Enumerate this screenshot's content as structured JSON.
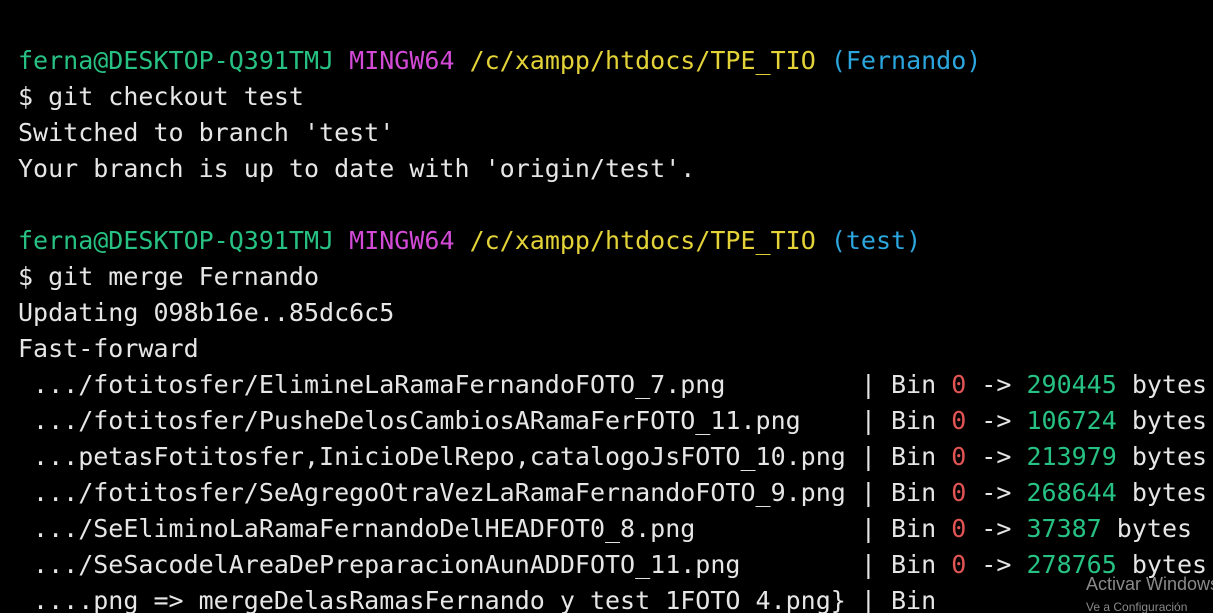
{
  "colors": {
    "background": "#000000",
    "foreground": "#e6e6e6",
    "user_host": "#27c283",
    "msystem": "#d24ad6",
    "path": "#e3d338",
    "branch": "#2ba6de",
    "removed": "#e45454",
    "added": "#27c283"
  },
  "prompts": [
    {
      "user_host": "ferna@DESKTOP-Q391TMJ",
      "msystem": "MINGW64",
      "path": "/c/xampp/htdocs/TPE_TIO",
      "branch": "(Fernando)",
      "command": "$ git checkout test",
      "output": [
        "Switched to branch 'test'",
        "Your branch is up to date with 'origin/test'."
      ]
    },
    {
      "user_host": "ferna@DESKTOP-Q391TMJ",
      "msystem": "MINGW64",
      "path": "/c/xampp/htdocs/TPE_TIO",
      "branch": "(test)",
      "command": "$ git merge Fernando",
      "output": [
        "Updating 098b16e..85dc6c5",
        "Fast-forward"
      ]
    }
  ],
  "diffstat": [
    {
      "file": " .../fotitosfer/ElimineLaRamaFernandoFOTO_7.png         ",
      "bin": "| Bin ",
      "from": "0",
      "arrow": " -> ",
      "to": "290445",
      "unit": " bytes"
    },
    {
      "file": " .../fotitosfer/PusheDelosCambiosARamaFerFOTO_11.png    ",
      "bin": "| Bin ",
      "from": "0",
      "arrow": " -> ",
      "to": "106724",
      "unit": " bytes"
    },
    {
      "file": " ...petasFotitosfer,InicioDelRepo,catalogoJsFOTO_10.png ",
      "bin": "| Bin ",
      "from": "0",
      "arrow": " -> ",
      "to": "213979",
      "unit": " bytes"
    },
    {
      "file": " .../fotitosfer/SeAgregoOtraVezLaRamaFernandoFOTO_9.png ",
      "bin": "| Bin ",
      "from": "0",
      "arrow": " -> ",
      "to": "268644",
      "unit": " bytes"
    },
    {
      "file": " .../SeEliminoLaRamaFernandoDelHEADFOT0_8.png           ",
      "bin": "| Bin ",
      "from": "0",
      "arrow": " -> ",
      "to": "37387",
      "unit": " bytes"
    },
    {
      "file": " .../SeSacodelAreaDePreparacionAunADDFOTO_11.png        ",
      "bin": "| Bin ",
      "from": "0",
      "arrow": " -> ",
      "to": "278765",
      "unit": " bytes"
    },
    {
      "file": " ....png => mergeDelasRamasFernando y test 1FOTO 4.png} ",
      "bin": "| Bin"
    }
  ],
  "watermark": {
    "title": "Activar Windows",
    "subtitle": "Ve a Configuración"
  }
}
